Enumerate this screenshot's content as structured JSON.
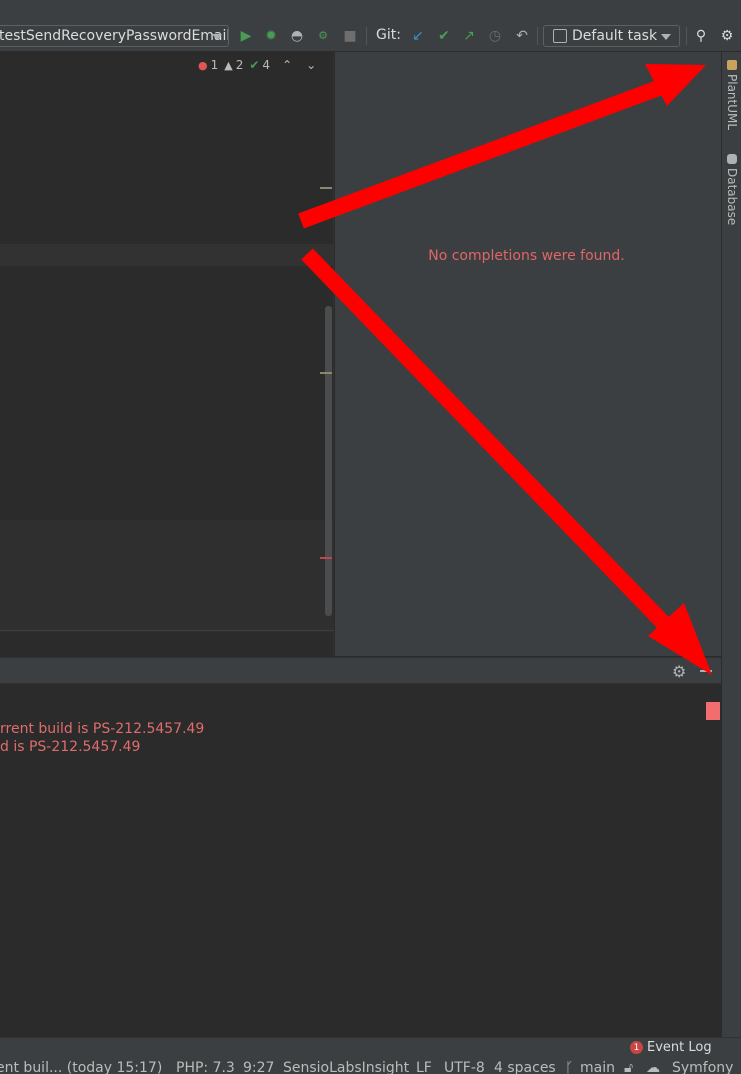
{
  "toolbar": {
    "run_config": "testSendRecoveryPasswordEmail",
    "git_label": "Git:",
    "task": "Default task"
  },
  "editor": {
    "inspections": {
      "errors": "1",
      "warnings": "2",
      "weak_warnings": "4"
    }
  },
  "completion_panel": {
    "message": "No completions were found."
  },
  "tool_stripe": {
    "tabs": [
      {
        "label": "PlantUML"
      },
      {
        "label": "Database"
      }
    ]
  },
  "log": {
    "lines": [
      "rrent build is PS-212.5457.49",
      "d is PS-212.5457.49"
    ]
  },
  "event_log": {
    "label": "Event Log",
    "count": "1"
  },
  "status_bar": {
    "message": "ent buil... (today 15:17)",
    "php": "PHP: 7.3",
    "position": "9:27",
    "insight": "SensioLabsInsight",
    "line_sep": "LF",
    "encoding": "UTF-8",
    "indent": "4 spaces",
    "branch": "main",
    "framework": "Symfony"
  },
  "colors": {
    "accent_error": "#e06666",
    "annotation_arrow": "#ff0000",
    "run_green": "#499c54",
    "git_blue": "#3592c4"
  }
}
